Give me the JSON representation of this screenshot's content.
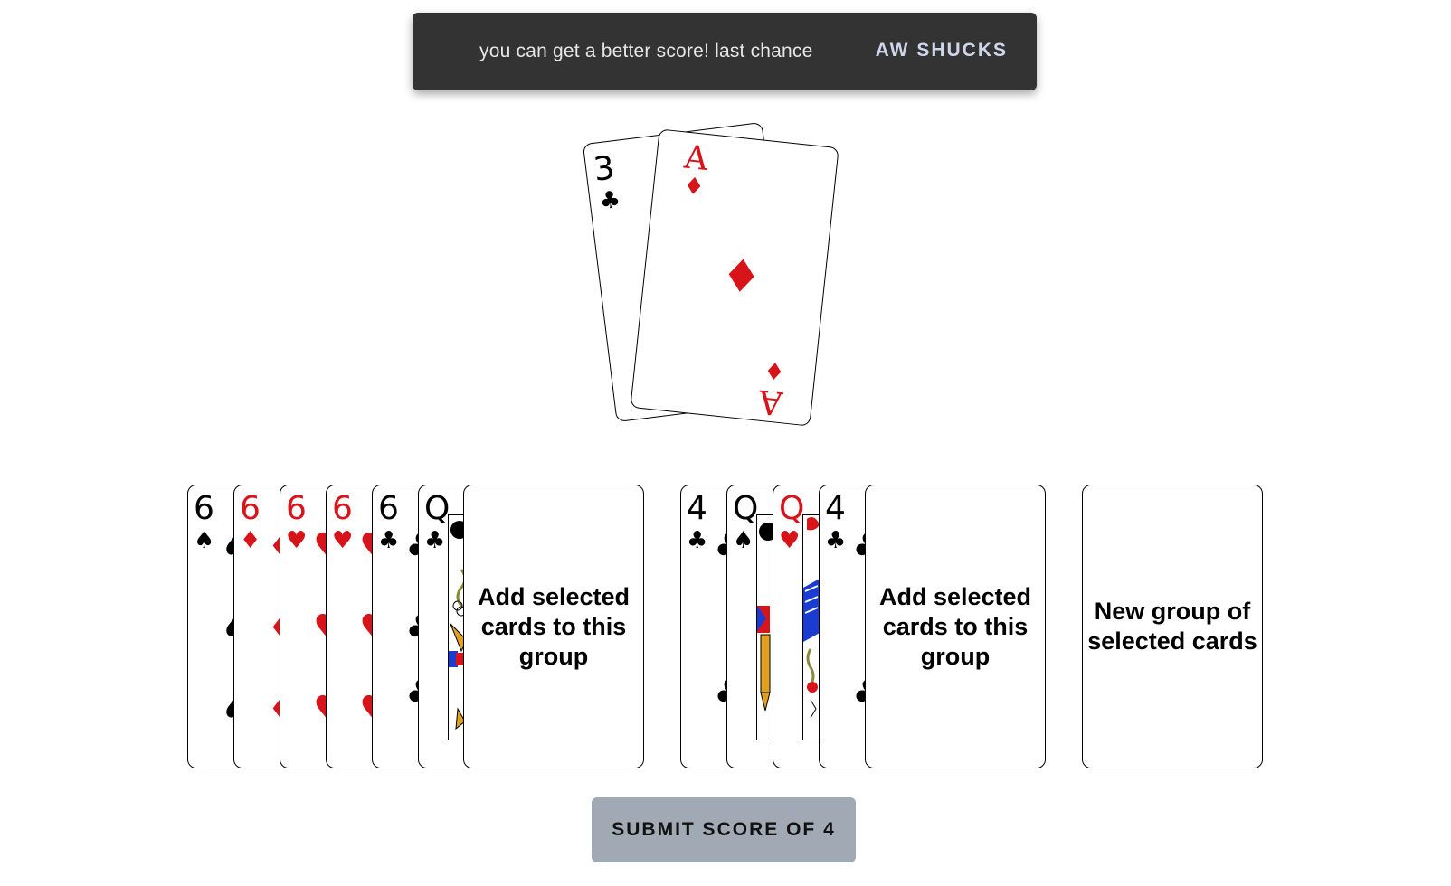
{
  "snackbar": {
    "message": "you can get a better score! last chance",
    "action_label": "AW SHUCKS"
  },
  "discard_pile": [
    {
      "rank": "3",
      "suit": "♣",
      "color": "#000000"
    },
    {
      "rank": "A",
      "suit": "♦",
      "color": "#d7141a"
    }
  ],
  "groups": [
    {
      "cards": [
        {
          "rank": "6",
          "suit": "♠"
        },
        {
          "rank": "6",
          "suit": "♦"
        },
        {
          "rank": "6",
          "suit": "♥"
        },
        {
          "rank": "6",
          "suit": "♥"
        },
        {
          "rank": "6",
          "suit": "♣"
        },
        {
          "rank": "Q",
          "suit": "♣"
        }
      ],
      "add_label": "Add selected cards to this group"
    },
    {
      "cards": [
        {
          "rank": "4",
          "suit": "♣"
        },
        {
          "rank": "Q",
          "suit": "♠"
        },
        {
          "rank": "Q",
          "suit": "♥"
        },
        {
          "rank": "4",
          "suit": "♣"
        }
      ],
      "add_label": "Add selected cards to this group"
    }
  ],
  "new_group_label": "New group of selected cards",
  "submit_label": "SUBMIT SCORE OF 4",
  "colors": {
    "red_suit": "#d7141a",
    "black_suit": "#000000",
    "snackbar_bg": "#333333",
    "submit_bg": "#a1a9b5"
  }
}
